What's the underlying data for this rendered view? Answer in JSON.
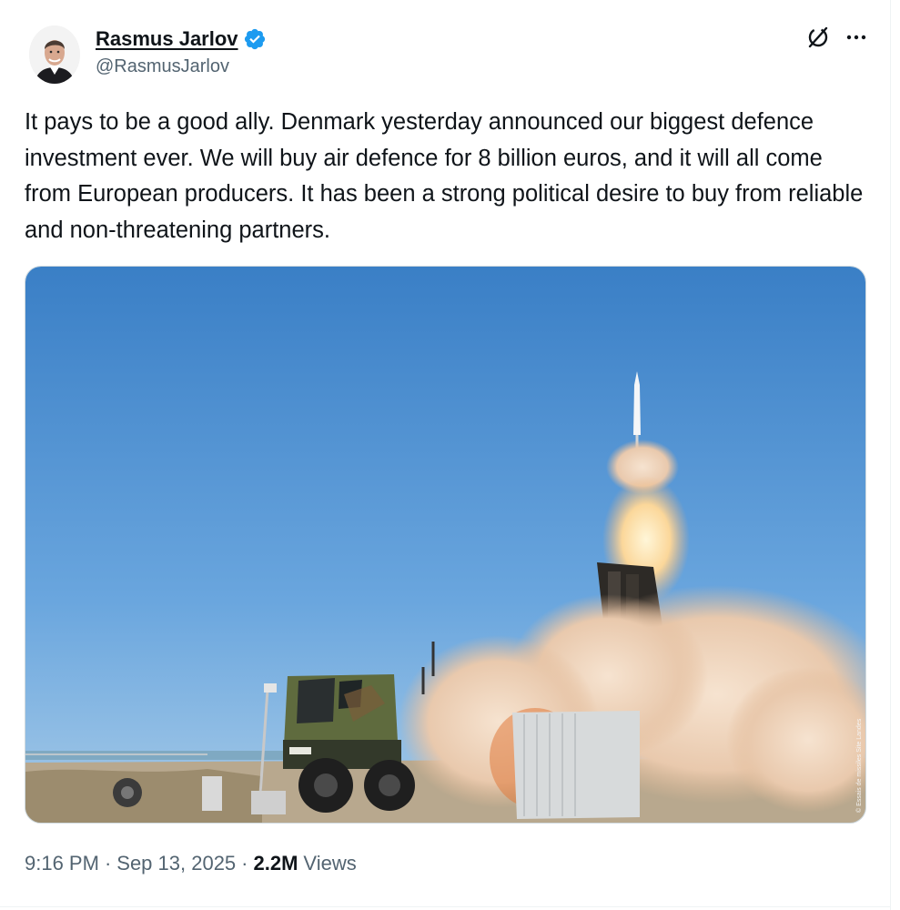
{
  "author": {
    "display_name": "Rasmus Jarlov",
    "handle": "@RasmusJarlov",
    "verified": true,
    "verified_color": "#1d9bf0"
  },
  "header_actions": {
    "grok_icon": "grok-icon",
    "more_icon": "more-icon",
    "more_label": "…"
  },
  "tweet": {
    "text": "It pays to be a good ally. Denmark yesterday announced our biggest defence investment ever. We will buy air defence for 8 billion euros, and it will all come from European producers. It has been a strong political desire to buy from reliable and non-threatening partners."
  },
  "media": {
    "credit": "© Essais de missiles Site Landes"
  },
  "meta": {
    "time": "9:16 PM",
    "date": "Sep 13, 2025",
    "dot": "·",
    "views_count": "2.2M",
    "views_label": "Views"
  },
  "colors": {
    "text_primary": "#0f1419",
    "text_secondary": "#536471",
    "border": "#cfd9de"
  }
}
